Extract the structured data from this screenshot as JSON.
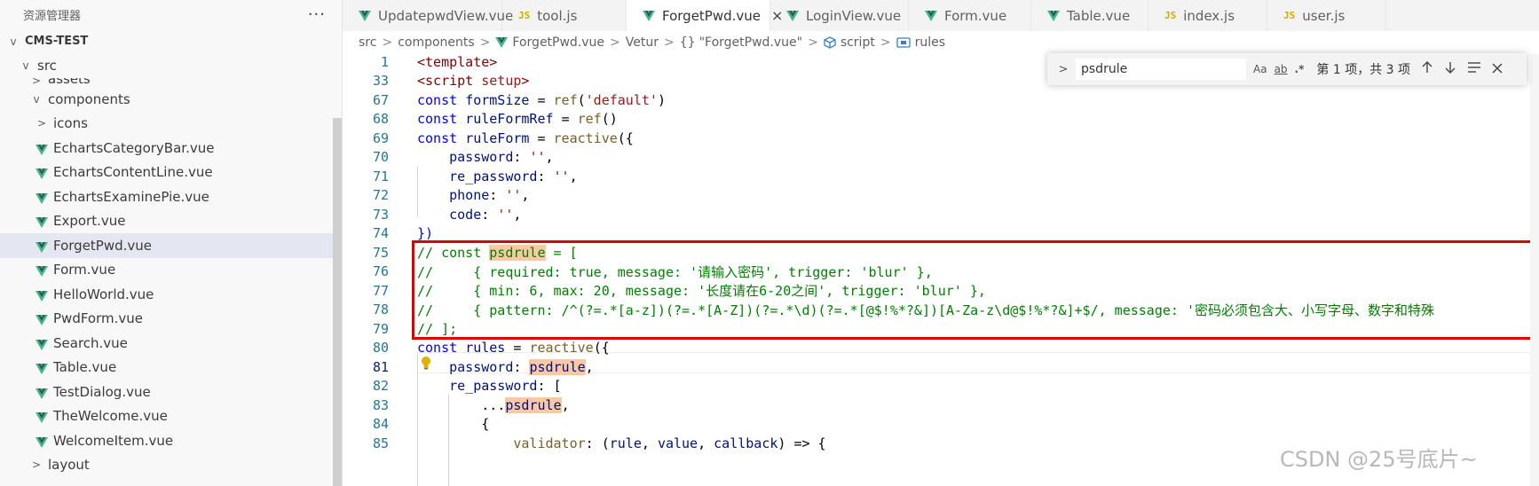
{
  "explorer": {
    "title": "资源管理器",
    "more": "···",
    "items": [
      {
        "label": "CMS-TEST",
        "chev": "v",
        "indent": 0,
        "kind": "root"
      },
      {
        "label": "src",
        "chev": "v",
        "indent": 1,
        "kind": "folder"
      },
      {
        "label": "assets",
        "chev": ">",
        "indent": 2,
        "kind": "folder"
      },
      {
        "label": "components",
        "chev": "v",
        "indent": 2,
        "kind": "folder"
      },
      {
        "label": "icons",
        "chev": ">",
        "indent": 3,
        "kind": "folder"
      },
      {
        "label": "EchartsCategoryBar.vue",
        "indent": 3,
        "kind": "vue"
      },
      {
        "label": "EchartsContentLine.vue",
        "indent": 3,
        "kind": "vue"
      },
      {
        "label": "EchartsExaminePie.vue",
        "indent": 3,
        "kind": "vue"
      },
      {
        "label": "Export.vue",
        "indent": 3,
        "kind": "vue"
      },
      {
        "label": "ForgetPwd.vue",
        "indent": 3,
        "kind": "vue",
        "active": true
      },
      {
        "label": "Form.vue",
        "indent": 3,
        "kind": "vue"
      },
      {
        "label": "HelloWorld.vue",
        "indent": 3,
        "kind": "vue"
      },
      {
        "label": "PwdForm.vue",
        "indent": 3,
        "kind": "vue"
      },
      {
        "label": "Search.vue",
        "indent": 3,
        "kind": "vue"
      },
      {
        "label": "Table.vue",
        "indent": 3,
        "kind": "vue"
      },
      {
        "label": "TestDialog.vue",
        "indent": 3,
        "kind": "vue"
      },
      {
        "label": "TheWelcome.vue",
        "indent": 3,
        "kind": "vue"
      },
      {
        "label": "WelcomeItem.vue",
        "indent": 3,
        "kind": "vue"
      },
      {
        "label": "layout",
        "chev": ">",
        "indent": 2,
        "kind": "folder"
      }
    ]
  },
  "tabs": [
    {
      "label": "UpdatepwdView.vue",
      "kind": "vue"
    },
    {
      "label": "tool.js",
      "kind": "js"
    },
    {
      "label": "ForgetPwd.vue",
      "kind": "vue",
      "active": true,
      "close": "×"
    },
    {
      "label": "LoginView.vue",
      "kind": "vue"
    },
    {
      "label": "Form.vue",
      "kind": "vue"
    },
    {
      "label": "Table.vue",
      "kind": "vue"
    },
    {
      "label": "index.js",
      "kind": "js"
    },
    {
      "label": "user.js",
      "kind": "js"
    }
  ],
  "js_badge": "JS",
  "breadcrumb": {
    "src": "src",
    "components": "components",
    "file": "ForgetPwd.vue",
    "vetur": "Vetur",
    "obj_icon": "{}",
    "obj": "\"ForgetPwd.vue\"",
    "script": "script",
    "rules": "rules",
    "sep": ">"
  },
  "find": {
    "toggle": ">",
    "query": "psdrule",
    "match_case": "Aa",
    "whole_word": "ab",
    "regex": ".*",
    "count": "第 1 项，共 3 项"
  },
  "code_lines": [
    {
      "num": "1",
      "tokens": [
        [
          "<template>",
          "tag"
        ]
      ]
    },
    {
      "num": "33",
      "tokens": [
        [
          "<script ",
          "tag"
        ],
        [
          "setup",
          "str"
        ],
        [
          ">",
          "tag"
        ]
      ]
    },
    {
      "num": "67",
      "tokens": [
        [
          "const ",
          "kw"
        ],
        [
          "formSize",
          "var"
        ],
        [
          " = ",
          "plain"
        ],
        [
          "ref",
          "fn"
        ],
        [
          "(",
          "plain"
        ],
        [
          "'default'",
          "str"
        ],
        [
          ")",
          "plain"
        ]
      ]
    },
    {
      "num": "68",
      "tokens": [
        [
          "const ",
          "kw"
        ],
        [
          "ruleFormRef",
          "var"
        ],
        [
          " = ",
          "plain"
        ],
        [
          "ref",
          "fn"
        ],
        [
          "()",
          "plain"
        ]
      ]
    },
    {
      "num": "69",
      "tokens": [
        [
          "const ",
          "kw"
        ],
        [
          "ruleForm",
          "var"
        ],
        [
          " = ",
          "plain"
        ],
        [
          "reactive",
          "fn"
        ],
        [
          "({",
          "plain"
        ]
      ]
    },
    {
      "num": "70",
      "tokens": [
        [
          "    password",
          "var"
        ],
        [
          ": ",
          "plain"
        ],
        [
          "''",
          "str"
        ],
        [
          ",",
          "plain"
        ]
      ]
    },
    {
      "num": "71",
      "tokens": [
        [
          "    re_password",
          "var"
        ],
        [
          ": ",
          "plain"
        ],
        [
          "''",
          "str"
        ],
        [
          ",",
          "plain"
        ]
      ]
    },
    {
      "num": "72",
      "tokens": [
        [
          "    phone",
          "var"
        ],
        [
          ": ",
          "plain"
        ],
        [
          "''",
          "str"
        ],
        [
          ",",
          "plain"
        ]
      ]
    },
    {
      "num": "73",
      "tokens": [
        [
          "    code",
          "var"
        ],
        [
          ": ",
          "plain"
        ],
        [
          "''",
          "str"
        ],
        [
          ",",
          "plain"
        ]
      ]
    },
    {
      "num": "74",
      "tokens": [
        [
          "})",
          "kw"
        ]
      ]
    },
    {
      "num": "75",
      "tokens": [
        [
          "// const ",
          "cmt"
        ],
        [
          "psdrule",
          "cmt-hl"
        ],
        [
          " = [",
          "cmt"
        ]
      ]
    },
    {
      "num": "76",
      "tokens": [
        [
          "//     { required: true, message: '请输入密码', trigger: 'blur' },",
          "cmt"
        ]
      ]
    },
    {
      "num": "77",
      "tokens": [
        [
          "//     { min: 6, max: 20, message: '长度请在6-20之间', trigger: 'blur' },",
          "cmt"
        ]
      ]
    },
    {
      "num": "78",
      "tokens": [
        [
          "//     { pattern: /^(?=.*[a-z])(?=.*[A-Z])(?=.*\\d)(?=.*[@$!%*?&])[A-Za-z\\d@$!%*?&]+$/, message: '密码必须包含大、小写字母、数字和特殊",
          "cmt"
        ]
      ]
    },
    {
      "num": "79",
      "tokens": [
        [
          "// ];",
          "cmt"
        ]
      ]
    },
    {
      "num": "80",
      "tokens": [
        [
          "const ",
          "kw"
        ],
        [
          "rules",
          "var"
        ],
        [
          " = ",
          "plain"
        ],
        [
          "reactive",
          "fn"
        ],
        [
          "({",
          "plain"
        ]
      ]
    },
    {
      "num": "81",
      "current": true,
      "tokens": [
        [
          "    password",
          "var"
        ],
        [
          ": ",
          "plain"
        ],
        [
          "psdrule",
          "var-hl"
        ],
        [
          ",",
          "plain"
        ]
      ]
    },
    {
      "num": "82",
      "tokens": [
        [
          "    re_password",
          "var"
        ],
        [
          ": [",
          "plain"
        ]
      ]
    },
    {
      "num": "83",
      "tokens": [
        [
          "        ...",
          "plain"
        ],
        [
          "psdrule",
          "var-hl"
        ],
        [
          ",",
          "plain"
        ]
      ]
    },
    {
      "num": "84",
      "tokens": [
        [
          "        {",
          "plain"
        ]
      ]
    },
    {
      "num": "85",
      "tokens": [
        [
          "            validator",
          "fn"
        ],
        [
          ": (",
          "plain"
        ],
        [
          "rule",
          "var"
        ],
        [
          ", ",
          "plain"
        ],
        [
          "value",
          "var"
        ],
        [
          ", ",
          "plain"
        ],
        [
          "callback",
          "var"
        ],
        [
          ") => {",
          "plain"
        ]
      ]
    }
  ],
  "watermark": "CSDN @25号底片~",
  "colors": {
    "vue_green": "#41b883",
    "vue_dark": "#35495e",
    "highlight_box": "#e00000",
    "match_highlight": "#f8c9a4"
  }
}
